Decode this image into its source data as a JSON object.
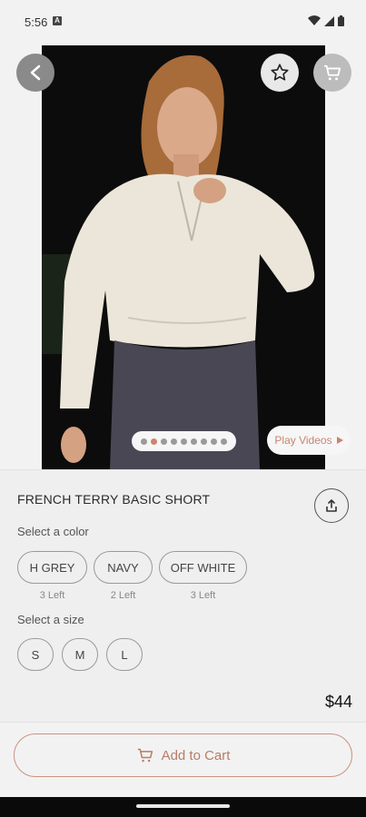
{
  "status_bar": {
    "time": "5:56",
    "notif_glyph": "A"
  },
  "media": {
    "play_videos_label": "Play Videos",
    "carousel_dot_count": 9,
    "carousel_active_index": 1
  },
  "product": {
    "name": "FRENCH TERRY BASIC SHORT",
    "price": "$44"
  },
  "color": {
    "label": "Select a color",
    "options": [
      {
        "name": "H GREY",
        "stock": "3 Left"
      },
      {
        "name": "NAVY",
        "stock": "2 Left"
      },
      {
        "name": "OFF WHITE",
        "stock": "3 Left"
      }
    ]
  },
  "size": {
    "label": "Select a size",
    "options": [
      "S",
      "M",
      "L"
    ]
  },
  "cta": {
    "add_to_cart_label": "Add to Cart"
  },
  "colors": {
    "accent": "#c7856e",
    "chip_border": "#9a9a9a"
  },
  "icons": [
    "back-arrow-icon",
    "star-icon",
    "cart-icon",
    "share-icon",
    "play-icon",
    "wifi-icon",
    "signal-icon",
    "battery-icon"
  ]
}
